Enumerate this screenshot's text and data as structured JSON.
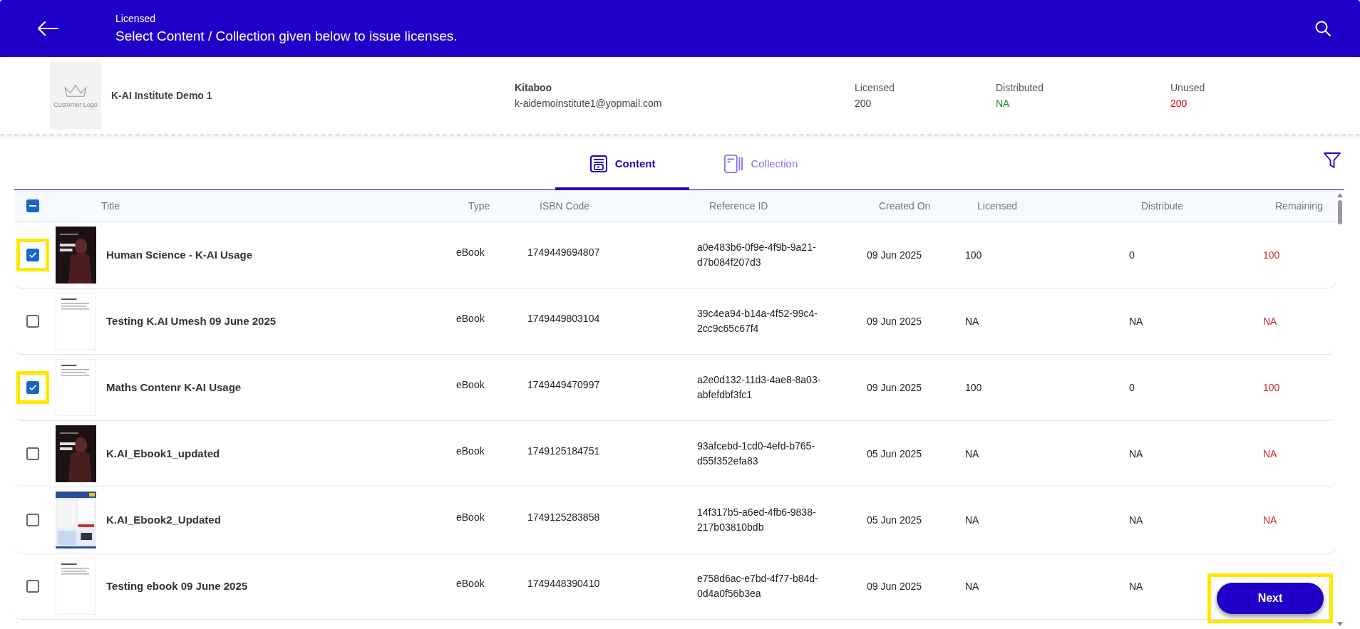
{
  "header": {
    "subtitle": "Licensed",
    "title": "Select Content / Collection given below to issue licenses."
  },
  "institute": {
    "logo_caption": "Customer Logo",
    "name": "K-AI Institute Demo 1",
    "org": "Kitaboo",
    "email": "k-aidemoinstitute1@yopmail.com"
  },
  "stats": [
    {
      "label": "Licensed",
      "value": "200",
      "color": "#444444"
    },
    {
      "label": "Distributed",
      "value": "NA",
      "color": "#1a8a1a"
    },
    {
      "label": "Unused",
      "value": "200",
      "color": "#e00000"
    }
  ],
  "tabs": [
    {
      "label": "Content",
      "selected": true
    },
    {
      "label": "Collection",
      "selected": false
    }
  ],
  "table": {
    "select_all_indeterminate": true,
    "columns": [
      "Title",
      "Type",
      "ISBN Code",
      "Reference ID",
      "Created On",
      "Licensed",
      "Distribute",
      "Remaining"
    ],
    "rows": [
      {
        "checked": true,
        "highlighted": true,
        "title": "Human Science - K-AI Usage",
        "type": "eBook",
        "isbn": "1749449694807",
        "reference_id": "a0e483b6-0f9e-4f9b-9a21-d7b084f207d3",
        "created_on": "09 Jun 2025",
        "licensed": "100",
        "distribute": "0",
        "remaining": "100"
      },
      {
        "checked": false,
        "highlighted": false,
        "title": "Testing K.AI Umesh 09 June 2025",
        "type": "eBook",
        "isbn": "1749449803104",
        "reference_id": "39c4ea94-b14a-4f52-99c4-2cc9c65c67f4",
        "created_on": "09 Jun 2025",
        "licensed": "NA",
        "distribute": "NA",
        "remaining": "NA"
      },
      {
        "checked": true,
        "highlighted": true,
        "title": "Maths Contenr K-AI Usage",
        "type": "eBook",
        "isbn": "1749449470997",
        "reference_id": "a2e0d132-11d3-4ae8-8a03-abfefdbf3fc1",
        "created_on": "09 Jun 2025",
        "licensed": "100",
        "distribute": "0",
        "remaining": "100"
      },
      {
        "checked": false,
        "highlighted": false,
        "title": "K.AI_Ebook1_updated",
        "type": "eBook",
        "isbn": "1749125184751",
        "reference_id": "93afcebd-1cd0-4efd-b765-d55f352efa83",
        "created_on": "05 Jun 2025",
        "licensed": "NA",
        "distribute": "NA",
        "remaining": "NA"
      },
      {
        "checked": false,
        "highlighted": false,
        "title": "K.AI_Ebook2_Updated",
        "type": "eBook",
        "isbn": "1749125283858",
        "reference_id": "14f317b5-a6ed-4fb6-9838-217b03810bdb",
        "created_on": "05 Jun 2025",
        "licensed": "NA",
        "distribute": "NA",
        "remaining": "NA"
      },
      {
        "checked": false,
        "highlighted": false,
        "title": "Testing ebook 09 June 2025",
        "type": "eBook",
        "isbn": "1749448390410",
        "reference_id": "e758d6ac-e7bd-4f77-b84d-0d4a0f56b3ea",
        "created_on": "09 Jun 2025",
        "licensed": "NA",
        "distribute": "NA"
      }
    ]
  },
  "next_button": {
    "label": "Next",
    "highlighted": true
  }
}
